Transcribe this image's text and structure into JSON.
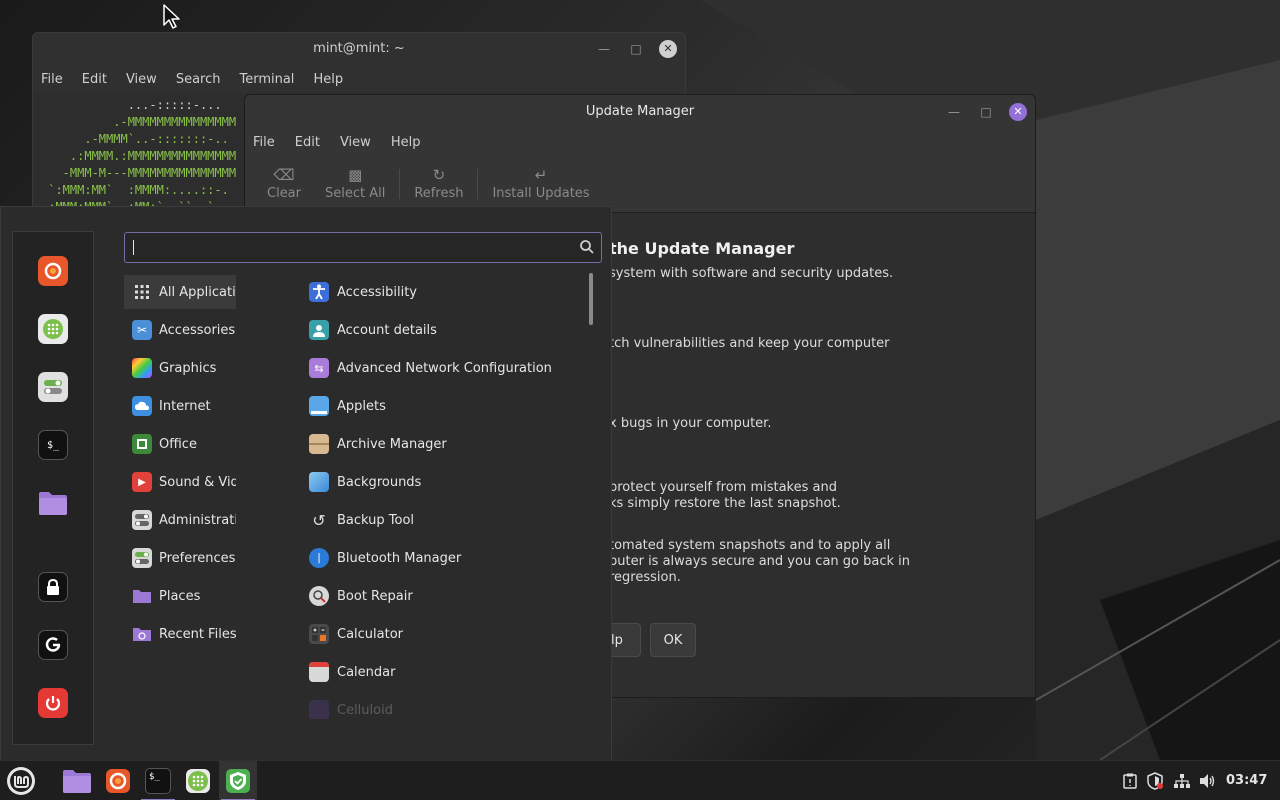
{
  "terminal": {
    "title": "mint@mint: ~",
    "menu": [
      "File",
      "Edit",
      "View",
      "Search",
      "Terminal",
      "Help"
    ],
    "lines": [
      "            ...-:::::-...",
      "          .-MMMMMMMMMMMMMMM",
      "      .-MMMM`..-:::::::-..",
      "    .:MMMM.:MMMMMMMMMMMMMMM",
      "   -MMM-M---MMMMMMMMMMMMMMM",
      " `:MMM:MM`  :MMMM:....::-.",
      " :MMM:MMM`  :MM:`  ``  `"
    ]
  },
  "update_manager": {
    "title": "Update Manager",
    "menu": [
      "File",
      "Edit",
      "View",
      "Help"
    ],
    "toolbar": [
      {
        "label": "Clear",
        "icon": "backspace-icon"
      },
      {
        "label": "Select All",
        "icon": "select-all-icon"
      },
      {
        "label": "Refresh",
        "icon": "refresh-icon"
      },
      {
        "label": "Install Updates",
        "icon": "install-icon"
      }
    ],
    "heading": "the Update Manager",
    "paragraphs": [
      "system with software and security updates.",
      "tch vulnerabilities and keep your computer",
      "x bugs in your computer.",
      "protect yourself from mistakes and",
      "ks simply restore the last snapshot.",
      "tomated system snapshots and to apply all",
      "puter is always secure and you can go back in",
      "regression."
    ],
    "help_button": "elp",
    "ok_button": "OK"
  },
  "app_menu": {
    "search": {
      "value": "",
      "placeholder": ""
    },
    "favorites": [
      {
        "name": "firefox-icon",
        "color": "#e8572a"
      },
      {
        "name": "software-manager-icon",
        "color": "#7cc04b"
      },
      {
        "name": "system-settings-icon",
        "color": "#d8d8d8"
      },
      {
        "name": "terminal-icon",
        "color": "#1c1c1c"
      },
      {
        "name": "files-icon",
        "color": "#9d79d6"
      },
      {
        "name": "lock-screen-icon",
        "color": "#1c1c1c"
      },
      {
        "name": "logout-icon",
        "color": "#1c1c1c"
      },
      {
        "name": "shutdown-icon",
        "color": "#e53935"
      }
    ],
    "categories": [
      {
        "label": "All Applications",
        "icon": "grid-icon",
        "color": "#3b3b3b"
      },
      {
        "label": "Accessories",
        "icon": "scissors-icon",
        "color": "#4a8fd8"
      },
      {
        "label": "Graphics",
        "icon": "graphics-icon",
        "color": "#c74bd8"
      },
      {
        "label": "Internet",
        "icon": "cloud-icon",
        "color": "#3e8fe0"
      },
      {
        "label": "Office",
        "icon": "office-icon",
        "color": "#3a8a3a"
      },
      {
        "label": "Sound & Video",
        "icon": "play-icon",
        "color": "#e0413a"
      },
      {
        "label": "Administration",
        "icon": "admin-icon",
        "color": "#d8d8d8"
      },
      {
        "label": "Preferences",
        "icon": "preferences-icon",
        "color": "#d8d8d8"
      },
      {
        "label": "Places",
        "icon": "folder-icon",
        "color": "#9d79d6"
      },
      {
        "label": "Recent Files",
        "icon": "recent-folder-icon",
        "color": "#9d79d6"
      }
    ],
    "apps": [
      {
        "label": "Accessibility",
        "icon": "accessibility-icon",
        "color": "#3e6fd8"
      },
      {
        "label": "Account details",
        "icon": "account-icon",
        "color": "#3aa0a8"
      },
      {
        "label": "Advanced Network Configuration",
        "icon": "network-config-icon",
        "color": "#a87cd8"
      },
      {
        "label": "Applets",
        "icon": "applets-icon",
        "color": "#5aa8e8"
      },
      {
        "label": "Archive Manager",
        "icon": "archive-icon",
        "color": "#d8b890"
      },
      {
        "label": "Backgrounds",
        "icon": "backgrounds-icon",
        "color": "#6ab0e8"
      },
      {
        "label": "Backup Tool",
        "icon": "backup-icon",
        "color": "#2b2b2b"
      },
      {
        "label": "Bluetooth Manager",
        "icon": "bluetooth-icon",
        "color": "#2a7ad8"
      },
      {
        "label": "Boot Repair",
        "icon": "boot-repair-icon",
        "color": "#d8d8d8"
      },
      {
        "label": "Calculator",
        "icon": "calculator-icon",
        "color": "#4a4a4a"
      },
      {
        "label": "Calendar",
        "icon": "calendar-icon",
        "color": "#d8d8d8"
      },
      {
        "label": "Celluloid",
        "icon": "celluloid-icon",
        "color": "#6a4ab0"
      }
    ]
  },
  "taskbar": {
    "items": [
      {
        "name": "menu-button",
        "color": "#e6e6e6"
      },
      {
        "name": "files-icon",
        "color": "#9d79d6"
      },
      {
        "name": "firefox-icon",
        "color": "#e8572a"
      },
      {
        "name": "terminal-icon",
        "color": "#1c1c1c"
      },
      {
        "name": "software-manager-icon",
        "color": "#7cc04b"
      },
      {
        "name": "update-manager-icon",
        "color": "#4caf50"
      }
    ],
    "tray": [
      "clipboard-icon",
      "shield-update-icon",
      "network-icon",
      "volume-icon"
    ],
    "clock": "03:47"
  },
  "colors": {
    "accent": "#8e7cc3",
    "close_button": "#9370d8"
  }
}
